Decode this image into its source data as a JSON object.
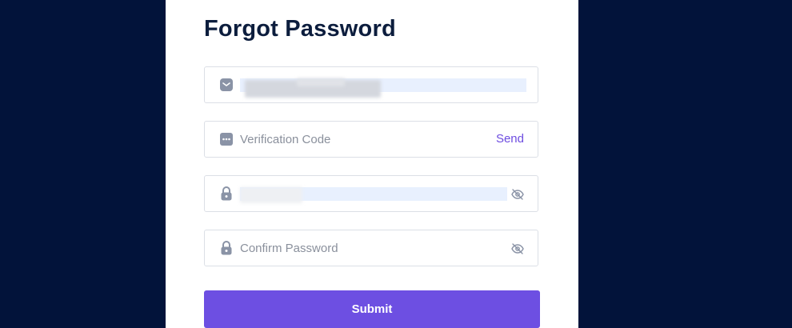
{
  "form": {
    "title": "Forgot Password",
    "email": {
      "value": "",
      "placeholder": "",
      "icon": "envelope-icon"
    },
    "verification_code": {
      "placeholder": "Verification Code",
      "icon": "message-dots-icon",
      "send_label": "Send"
    },
    "password": {
      "value": "",
      "placeholder": "",
      "icon": "lock-icon",
      "toggle_icon": "eye-off-icon"
    },
    "confirm_password": {
      "placeholder": "Confirm Password",
      "icon": "lock-icon",
      "toggle_icon": "eye-off-icon"
    },
    "submit_label": "Submit"
  },
  "colors": {
    "background": "#02133a",
    "card": "#ffffff",
    "accent": "#6d4fe2",
    "title": "#0c1d3d",
    "icon": "#8a93a6",
    "autofill": "#e8f0fe"
  }
}
